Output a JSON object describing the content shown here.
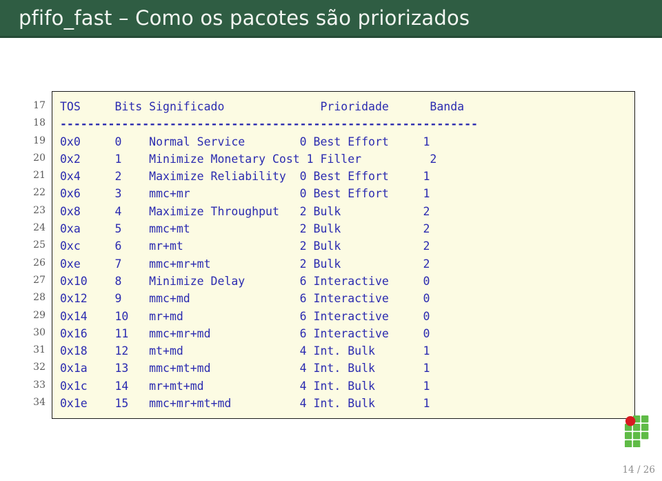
{
  "slide": {
    "title": "pfifo_fast – Como os pacotes são priorizados",
    "page_indicator": "14 / 26",
    "header_color": "#2f5d43",
    "code_bg_color": "#fcfbe3",
    "code_text_color": "#2b2bb0"
  },
  "listing": {
    "first_line_number": 17,
    "line_numbers": [
      17,
      18,
      19,
      20,
      21,
      22,
      23,
      24,
      25,
      26,
      27,
      28,
      29,
      30,
      31,
      32,
      33,
      34
    ],
    "columns": [
      "TOS",
      "Bits",
      "Significado",
      "Prioridade",
      "Banda"
    ],
    "header_line": "TOS     Bits Significado              Prioridade      Banda",
    "separator_line": "-------------------------------------------------------------",
    "rows": [
      {
        "tos": "0x0",
        "bits": "0",
        "significado": "Normal Service",
        "prio_num": "0",
        "prioridade": "Best Effort",
        "banda": "1"
      },
      {
        "tos": "0x2",
        "bits": "1",
        "significado": "Minimize Monetary Cost",
        "prio_num": "1",
        "prioridade": "Filler",
        "banda": "2"
      },
      {
        "tos": "0x4",
        "bits": "2",
        "significado": "Maximize Reliability",
        "prio_num": "0",
        "prioridade": "Best Effort",
        "banda": "1"
      },
      {
        "tos": "0x6",
        "bits": "3",
        "significado": "mmc+mr",
        "prio_num": "0",
        "prioridade": "Best Effort",
        "banda": "1"
      },
      {
        "tos": "0x8",
        "bits": "4",
        "significado": "Maximize Throughput",
        "prio_num": "2",
        "prioridade": "Bulk",
        "banda": "2"
      },
      {
        "tos": "0xa",
        "bits": "5",
        "significado": "mmc+mt",
        "prio_num": "2",
        "prioridade": "Bulk",
        "banda": "2"
      },
      {
        "tos": "0xc",
        "bits": "6",
        "significado": "mr+mt",
        "prio_num": "2",
        "prioridade": "Bulk",
        "banda": "2"
      },
      {
        "tos": "0xe",
        "bits": "7",
        "significado": "mmc+mr+mt",
        "prio_num": "2",
        "prioridade": "Bulk",
        "banda": "2"
      },
      {
        "tos": "0x10",
        "bits": "8",
        "significado": "Minimize Delay",
        "prio_num": "6",
        "prioridade": "Interactive",
        "banda": "0"
      },
      {
        "tos": "0x12",
        "bits": "9",
        "significado": "mmc+md",
        "prio_num": "6",
        "prioridade": "Interactive",
        "banda": "0"
      },
      {
        "tos": "0x14",
        "bits": "10",
        "significado": "mr+md",
        "prio_num": "6",
        "prioridade": "Interactive",
        "banda": "0"
      },
      {
        "tos": "0x16",
        "bits": "11",
        "significado": "mmc+mr+md",
        "prio_num": "6",
        "prioridade": "Interactive",
        "banda": "0"
      },
      {
        "tos": "0x18",
        "bits": "12",
        "significado": "mt+md",
        "prio_num": "4",
        "prioridade": "Int. Bulk",
        "banda": "1"
      },
      {
        "tos": "0x1a",
        "bits": "13",
        "significado": "mmc+mt+md",
        "prio_num": "4",
        "prioridade": "Int. Bulk",
        "banda": "1"
      },
      {
        "tos": "0x1c",
        "bits": "14",
        "significado": "mr+mt+md",
        "prio_num": "4",
        "prioridade": "Int. Bulk",
        "banda": "1"
      },
      {
        "tos": "0x1e",
        "bits": "15",
        "significado": "mmc+mr+mt+md",
        "prio_num": "4",
        "prioridade": "Int. Bulk",
        "banda": "1"
      }
    ]
  },
  "logo": {
    "name": "ifrn-logo",
    "dot_color": "#d71a21",
    "block_color": "#5fbb46"
  }
}
